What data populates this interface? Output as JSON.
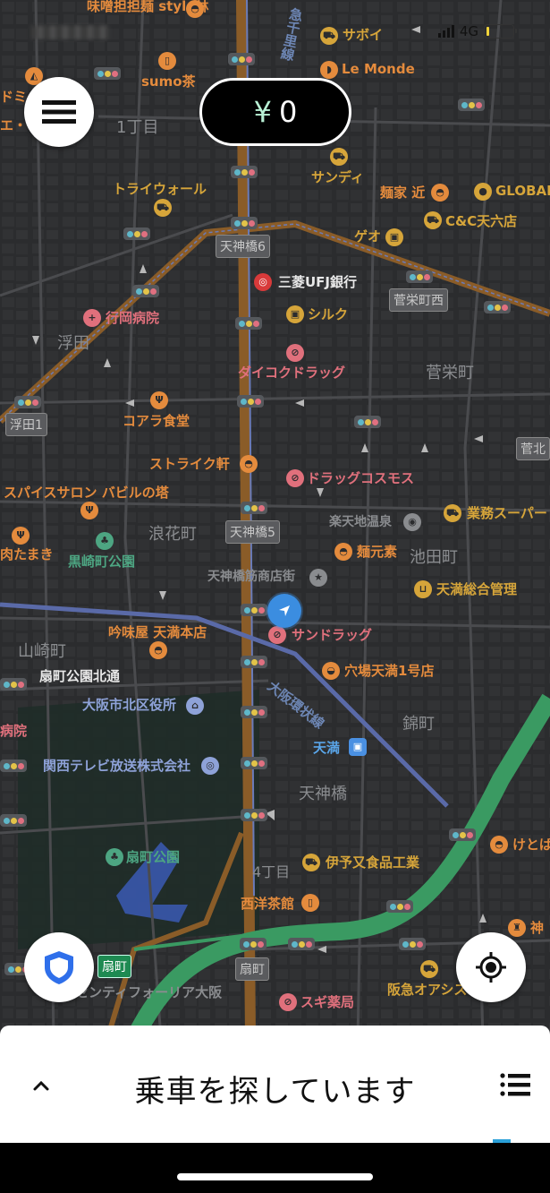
{
  "status_bar": {
    "network": "4G",
    "battery_level_percent": 10,
    "carrier_blurred": true
  },
  "fare": {
    "currency": "¥",
    "amount": "0"
  },
  "map": {
    "district_labels": [
      {
        "text": "1丁目"
      },
      {
        "text": "浮田"
      },
      {
        "text": "菅栄町"
      },
      {
        "text": "浪花町"
      },
      {
        "text": "池田町"
      },
      {
        "text": "山崎町"
      },
      {
        "text": "錦町"
      },
      {
        "text": "天神橋"
      },
      {
        "text": "4丁目"
      }
    ],
    "road_signs": [
      {
        "text": "天神橋6"
      },
      {
        "text": "菅栄町西"
      },
      {
        "text": "浮田1"
      },
      {
        "text": "菅北"
      },
      {
        "text": "天神橋5"
      },
      {
        "text": "扇町"
      },
      {
        "text": "扇町"
      }
    ],
    "rail_labels": [
      {
        "text": "急千里線"
      },
      {
        "text": "大阪環状線"
      }
    ],
    "pois": [
      {
        "name": "味噌担担麺 style林",
        "category": "restaurant",
        "color": "orange"
      },
      {
        "name": "サボイ",
        "category": "shopping",
        "color": "yellow"
      },
      {
        "name": "Le Monde",
        "category": "bakery",
        "color": "orange"
      },
      {
        "name": "sumo茶",
        "category": "cafe",
        "color": "orange"
      },
      {
        "name": "ドミ",
        "category": "restaurant",
        "color": "orange"
      },
      {
        "name": "エ・",
        "category": "restaurant",
        "color": "orange"
      },
      {
        "name": "サンディ",
        "category": "shopping",
        "color": "yellow"
      },
      {
        "name": "トライウォール",
        "category": "shopping",
        "color": "yellow"
      },
      {
        "name": "麺家 近",
        "category": "ramen",
        "color": "orange"
      },
      {
        "name": "GLOBAL",
        "category": "pet",
        "color": "yellow"
      },
      {
        "name": "C&C天六店",
        "category": "shopping",
        "color": "yellow"
      },
      {
        "name": "ゲオ",
        "category": "store",
        "color": "yellow"
      },
      {
        "name": "三菱UFJ銀行",
        "category": "bank",
        "color": "red"
      },
      {
        "name": "行岡病院",
        "category": "hospital",
        "color": "pink"
      },
      {
        "name": "シルク",
        "category": "store",
        "color": "yellow"
      },
      {
        "name": "ダイコクドラッグ",
        "category": "pharmacy",
        "color": "pink"
      },
      {
        "name": "コアラ食堂",
        "category": "restaurant",
        "color": "orange"
      },
      {
        "name": "ストライク軒",
        "category": "ramen",
        "color": "orange"
      },
      {
        "name": "ドラッグコスモス",
        "category": "pharmacy",
        "color": "pink"
      },
      {
        "name": "スパイスサロン バビルの塔",
        "category": "restaurant",
        "color": "orange"
      },
      {
        "name": "業務スーパー",
        "category": "shopping",
        "color": "yellow"
      },
      {
        "name": "楽天地温泉",
        "category": "spa",
        "color": "grey"
      },
      {
        "name": "肉たまき",
        "category": "restaurant",
        "color": "orange"
      },
      {
        "name": "黒崎町公園",
        "category": "park",
        "color": "green"
      },
      {
        "name": "麺元素",
        "category": "ramen",
        "color": "orange"
      },
      {
        "name": "天神橋筋商店街",
        "category": "landmark",
        "color": "grey"
      },
      {
        "name": "天満総合管理",
        "category": "store",
        "color": "yellow"
      },
      {
        "name": "吟味屋 天満本店",
        "category": "restaurant",
        "color": "orange"
      },
      {
        "name": "サンドラッグ",
        "category": "pharmacy",
        "color": "pink"
      },
      {
        "name": "扇町公園北通",
        "category": "street",
        "color": "white"
      },
      {
        "name": "穴場天満1号店",
        "category": "restaurant",
        "color": "orange"
      },
      {
        "name": "大阪市北区役所",
        "category": "government",
        "color": "blue"
      },
      {
        "name": "病院",
        "category": "hospital",
        "color": "pink"
      },
      {
        "name": "天満",
        "category": "station",
        "color": "skyblue"
      },
      {
        "name": "関西テレビ放送株式会社",
        "category": "broadcast",
        "color": "blue"
      },
      {
        "name": "けとば",
        "category": "restaurant",
        "color": "orange"
      },
      {
        "name": "扇町公園",
        "category": "park",
        "color": "green"
      },
      {
        "name": "伊予又食品工業",
        "category": "shopping",
        "color": "yellow"
      },
      {
        "name": "西洋茶館",
        "category": "cafe",
        "color": "orange"
      },
      {
        "name": "神",
        "category": "bar",
        "color": "orange"
      },
      {
        "name": "阪急オアシス",
        "category": "shopping",
        "color": "yellow"
      },
      {
        "name": "センティフォーリア大阪",
        "category": "building",
        "color": "grey"
      },
      {
        "name": "スギ薬局",
        "category": "pharmacy",
        "color": "pink"
      }
    ]
  },
  "controls": {
    "menu": "menu-icon",
    "safety": "shield-icon",
    "recenter": "locate-icon"
  },
  "sheet": {
    "title": "乗車を探しています",
    "expand_icon": "chevron-up-icon",
    "list_icon": "list-icon"
  },
  "colors": {
    "map_bg": "#2b2c2e",
    "fare_pill_bg": "#000000",
    "yen_color": "#b8f0d4",
    "shield_blue": "#2f6fea",
    "expressway_green": "#3a9a62",
    "main_road_brown": "#8a5c28",
    "accent": "#2aa0d8"
  }
}
